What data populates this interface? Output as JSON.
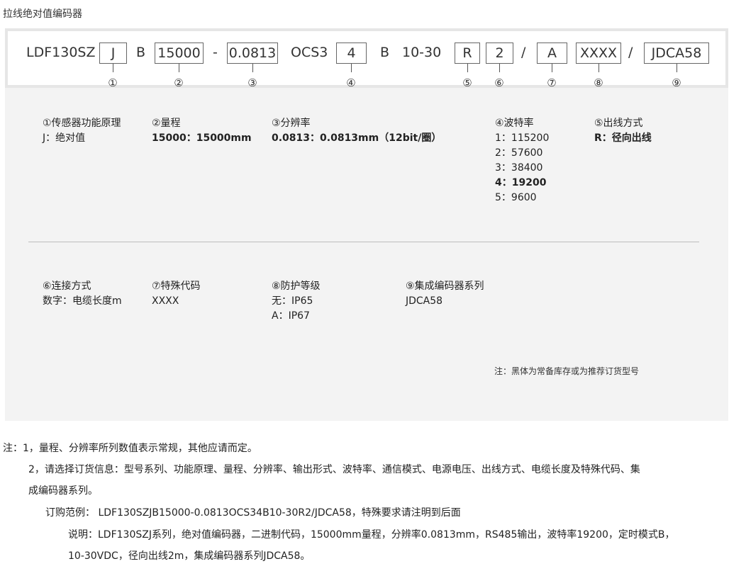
{
  "title": "拉线绝对值编码器",
  "code": {
    "segments": [
      {
        "text": "LDF130SZ",
        "boxed": false
      },
      {
        "text": "J",
        "boxed": true
      },
      {
        "text": "B",
        "boxed": false
      },
      {
        "text": "15000",
        "boxed": true
      },
      {
        "text": "-",
        "boxed": false
      },
      {
        "text": "0.0813",
        "boxed": true
      },
      {
        "text": "OCS3",
        "boxed": false
      },
      {
        "text": "4",
        "boxed": true
      },
      {
        "text": "B",
        "boxed": false
      },
      {
        "text": "10-30",
        "boxed": false
      },
      {
        "text": "R",
        "boxed": true
      },
      {
        "text": "2",
        "boxed": true
      },
      {
        "text": "/",
        "boxed": false
      },
      {
        "text": "A",
        "boxed": true
      },
      {
        "text": "XXXX",
        "boxed": true
      },
      {
        "text": "/",
        "boxed": false
      },
      {
        "text": "JDCA58",
        "boxed": true
      }
    ],
    "markers": [
      "①",
      "②",
      "③",
      "④",
      "⑤",
      "⑥",
      "⑦",
      "⑧",
      "⑨"
    ]
  },
  "specs": {
    "s1": {
      "heading": "①传感器功能原理",
      "values": [
        {
          "text": "J：绝对值",
          "bold": false
        }
      ]
    },
    "s2": {
      "heading": "②量程",
      "values": [
        {
          "text": "15000：15000mm",
          "bold": true
        }
      ]
    },
    "s3": {
      "heading": "③分辨率",
      "values": [
        {
          "text": "0.0813：0.0813mm（12bit/圈）",
          "bold": true
        }
      ]
    },
    "s4": {
      "heading": "④波特率",
      "values": [
        {
          "text": "1：115200",
          "bold": false
        },
        {
          "text": "2：57600",
          "bold": false
        },
        {
          "text": "3：38400",
          "bold": false
        },
        {
          "text": "4：19200",
          "bold": true
        },
        {
          "text": "5：9600",
          "bold": false
        }
      ]
    },
    "s5": {
      "heading": "⑤出线方式",
      "values": [
        {
          "text": "R：径向出线",
          "bold": true
        }
      ]
    },
    "s6": {
      "heading": "⑥连接方式",
      "values": [
        {
          "text": "数字：电缆长度m",
          "bold": false
        }
      ]
    },
    "s7": {
      "heading": "⑦特殊代码",
      "values": [
        {
          "text": "XXXX",
          "bold": false
        }
      ]
    },
    "s8": {
      "heading": "⑧防护等级",
      "values": [
        {
          "text": "无：IP65",
          "bold": false
        },
        {
          "text": "A：IP67",
          "bold": false
        }
      ]
    },
    "s9": {
      "heading": "⑨集成编码器系列",
      "values": [
        {
          "text": "JDCA58",
          "bold": false
        }
      ]
    }
  },
  "panel_note": "注：黑体为常备库存或为推荐订货型号",
  "notes": {
    "n1": "注：1，量程、分辨率所列数值表示常规，其他应请而定。",
    "n2a": "2，请选择订货信息：型号系列、功能原理、量程、分辨率、输出形式、波特率、通信模式、电源电压、出线方式、电缆长度及特殊代码、集",
    "n2b": "成编码器系列。",
    "n3": "订购范例：  LDF130SZJB15000-0.0813OCS34B10-30R2/JDCA58，特殊要求请注明到后面",
    "n4a": "说明：LDF130SZJ系列，绝对值编码器，二进制代码，15000mm量程，分辨率0.0813mm，RS485输出，波特率19200，定时模式B，",
    "n4b": "10-30VDC，径向出线2m，集成编码器系列JDCA58。"
  }
}
